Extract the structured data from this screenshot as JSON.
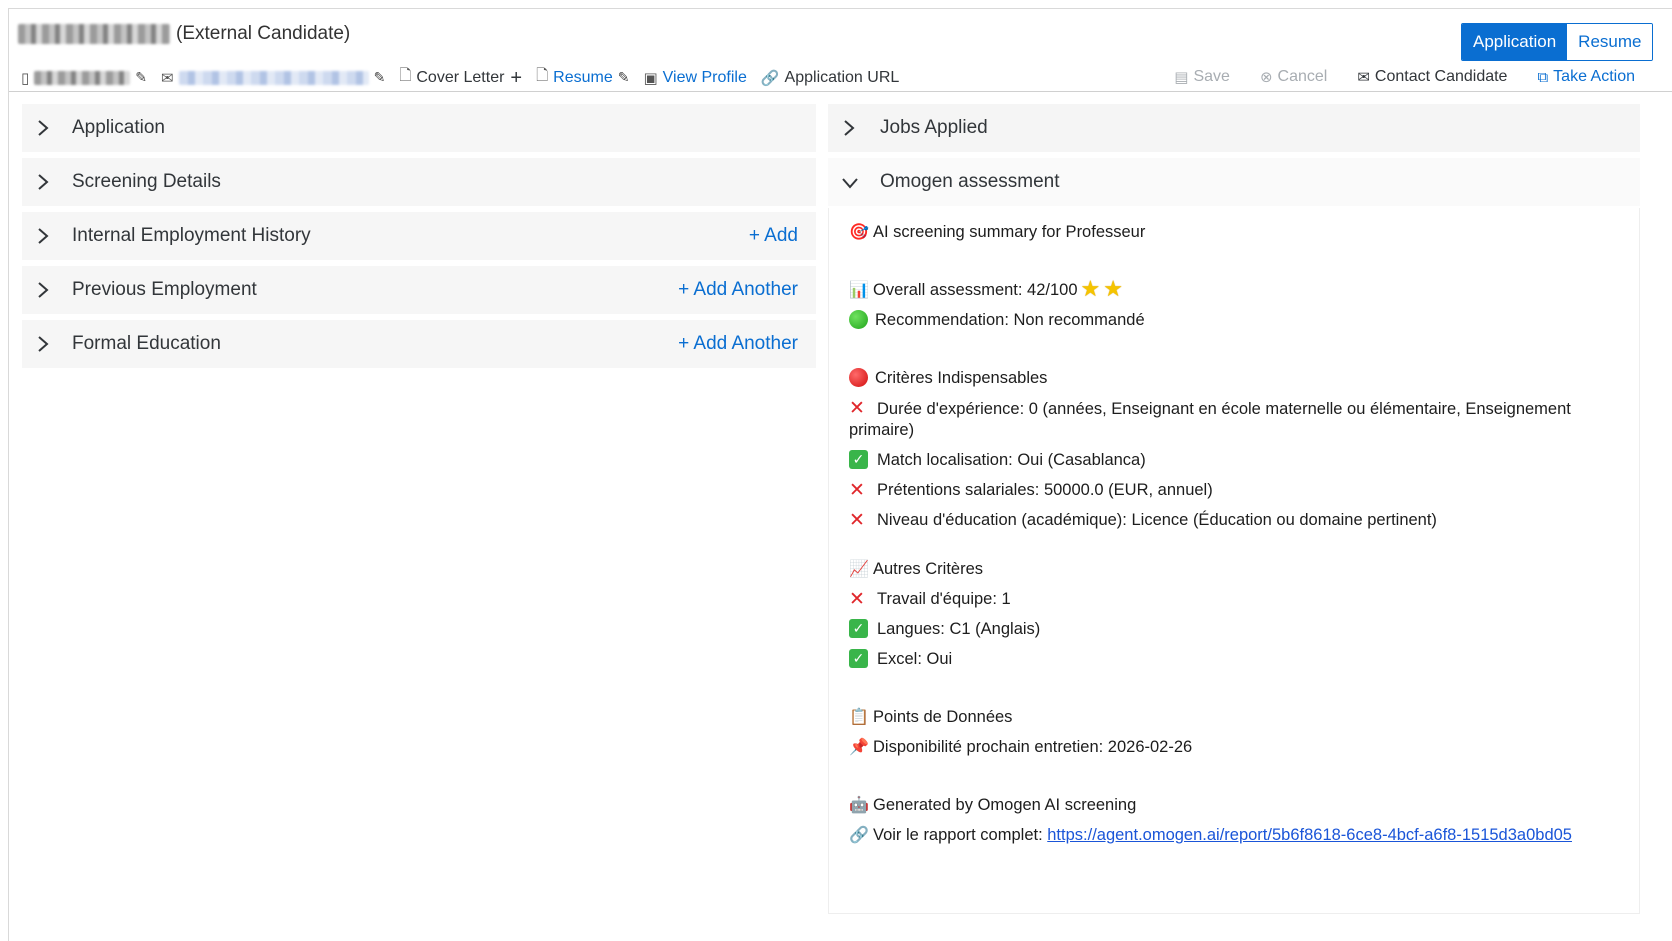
{
  "header": {
    "candidate_type": "(External Candidate)",
    "cover_letter": "Cover Letter",
    "resume_link": "Resume",
    "view_profile": "View Profile",
    "application_url": "Application URL",
    "toggle": {
      "application": "Application",
      "resume": "Resume"
    },
    "actions": {
      "save": "Save",
      "cancel": "Cancel",
      "contact": "Contact Candidate",
      "take_action": "Take Action"
    }
  },
  "left_sections": [
    {
      "title": "Application",
      "action": ""
    },
    {
      "title": "Screening Details",
      "action": ""
    },
    {
      "title": "Internal Employment History",
      "action": "+ Add"
    },
    {
      "title": "Previous Employment",
      "action": "+ Add Another"
    },
    {
      "title": "Formal Education",
      "action": "+ Add Another"
    }
  ],
  "right_sections": {
    "jobs_applied": "Jobs Applied",
    "omogen": "Omogen assessment"
  },
  "assessment": {
    "summary": "AI screening summary for Professeur",
    "overall": "Overall assessment: 42/100",
    "stars": 2,
    "star_glyph": "★",
    "recommendation": "Recommendation: Non recommandé",
    "indispensable_title": "Critères Indispensables",
    "indispensable": [
      {
        "status": "fail",
        "label": "Durée d'expérience:",
        "value": "0 (années, Enseignant en école maternelle ou élémentaire, Enseignement primaire)"
      },
      {
        "status": "pass",
        "label": "Match localisation:",
        "value": "Oui (Casablanca)"
      },
      {
        "status": "fail",
        "label": "Prétentions salariales:",
        "value": "50000.0 (EUR, annuel)"
      },
      {
        "status": "fail",
        "label": "Niveau d'éducation (académique):",
        "value": "Licence (Éducation ou domaine pertinent)"
      }
    ],
    "autres_title": "Autres Critères",
    "autres": [
      {
        "status": "fail",
        "label": "Travail d'équipe:",
        "value": "1"
      },
      {
        "status": "pass",
        "label": "Langues:",
        "value": "C1 (Anglais)"
      },
      {
        "status": "pass",
        "label": "Excel:",
        "value": "Oui"
      }
    ],
    "points_title": "Points de Données",
    "point": "Disponibilité prochain entretien: 2026-02-26",
    "generated": "Generated by Omogen AI screening",
    "report_label": "Voir le rapport complet: ",
    "report_url": "https://agent.omogen.ai/report/5b6f8618-6ce8-4bcf-a6f8-1515d3a0bd05"
  },
  "icons": {
    "phone": "phone-icon",
    "mail": "mail-icon",
    "pencil": "pencil-icon",
    "doc": "document-icon",
    "plus": "plus-icon",
    "profile": "profile-card-icon",
    "link": "link-icon",
    "save": "save-icon",
    "cancel": "cancel-icon",
    "envelope": "envelope-icon",
    "external": "external-link-icon",
    "chevron_right": "chevron-right-icon",
    "chevron_down": "chevron-down-icon"
  },
  "colors": {
    "accent": "#0a6ed1",
    "fail": "#e0262b",
    "pass": "#39b54a",
    "section_bg": "#f6f6f6"
  }
}
